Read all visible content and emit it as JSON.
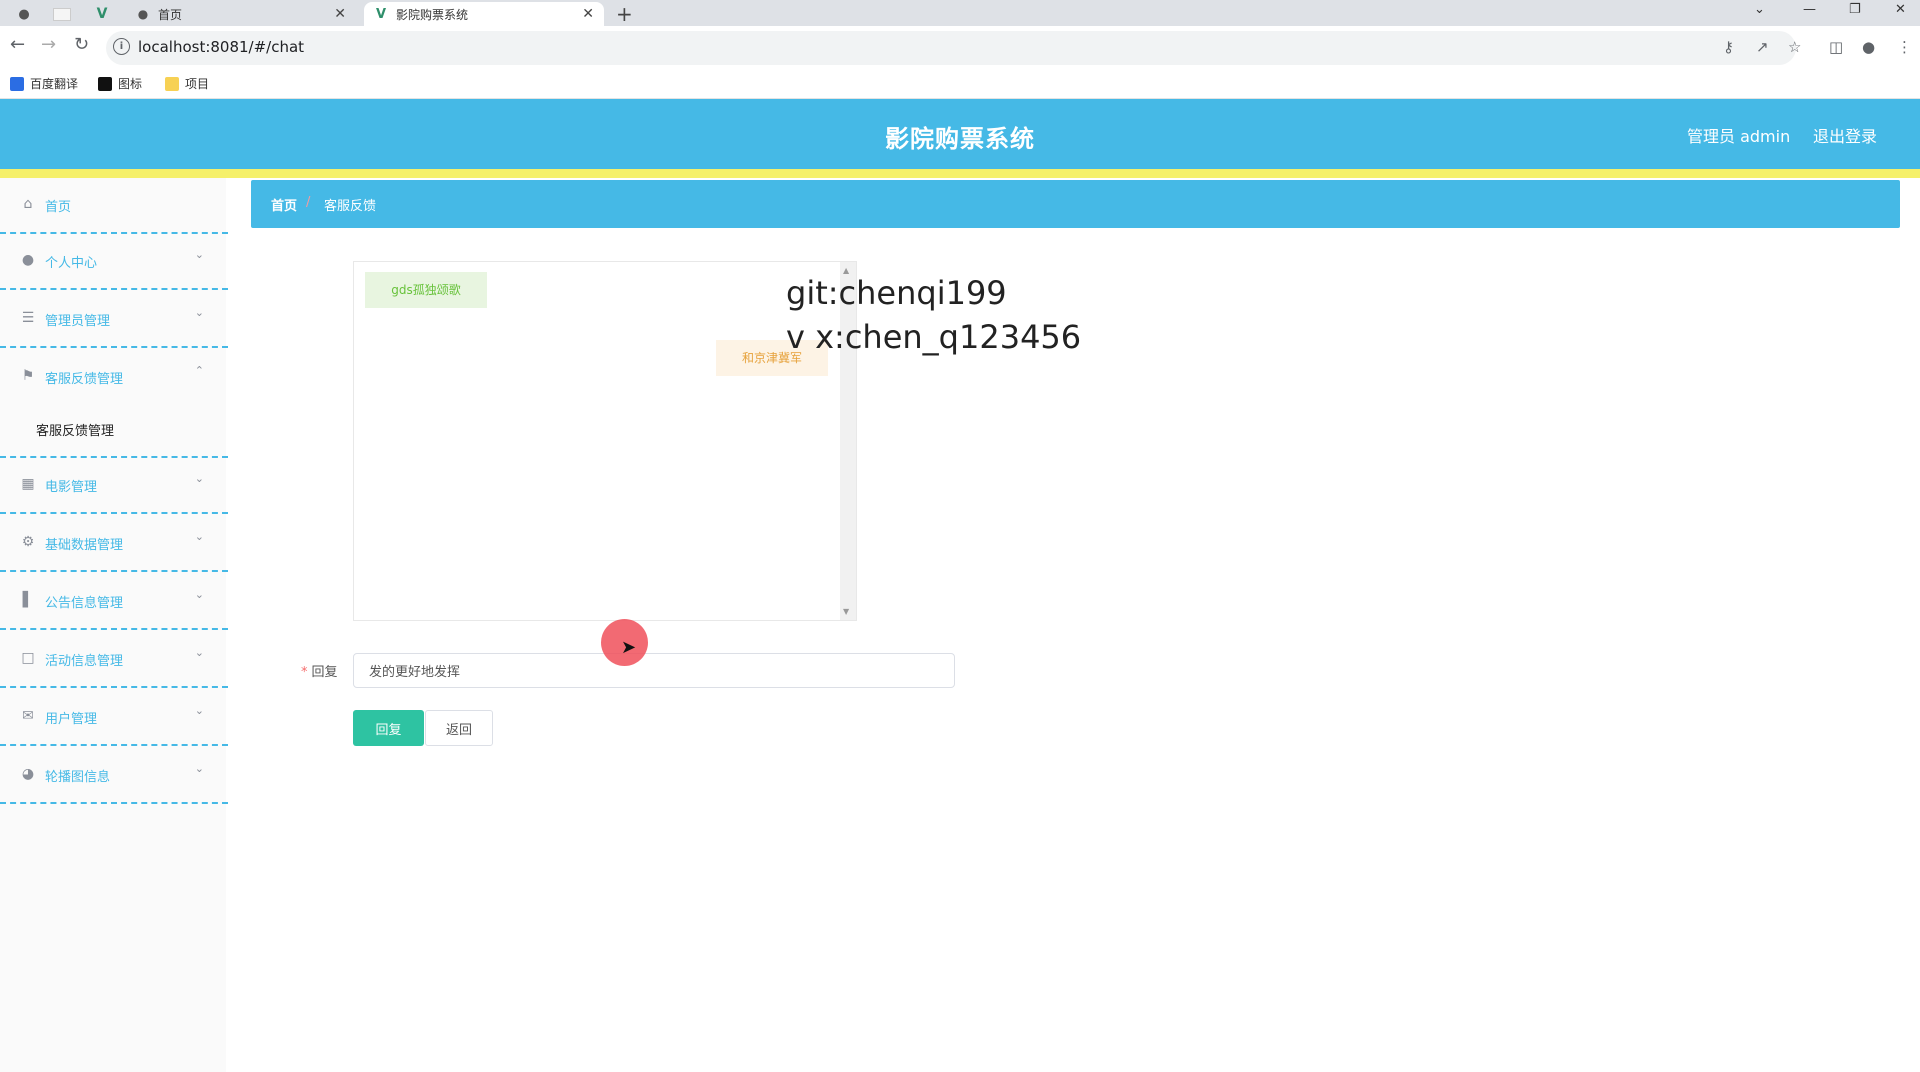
{
  "browser": {
    "tabs": [
      {
        "title": "首页"
      },
      {
        "title": "影院购票系统"
      }
    ],
    "new_tab": "+",
    "url": "localhost:8081/#/chat",
    "bookmarks": [
      {
        "label": "百度翻译"
      },
      {
        "label": "图标"
      },
      {
        "label": "项目"
      }
    ]
  },
  "header": {
    "title": "影院购票系统",
    "admin": "管理员 admin",
    "logout": "退出登录"
  },
  "sidebar": {
    "items": [
      {
        "label": "首页",
        "icon": "home-icon"
      },
      {
        "label": "个人中心",
        "icon": "user-icon"
      },
      {
        "label": "管理员管理",
        "icon": "list-icon"
      },
      {
        "label": "客服反馈管理",
        "icon": "flag-icon"
      },
      {
        "label": "电影管理",
        "icon": "grid-icon"
      },
      {
        "label": "基础数据管理",
        "icon": "settings-icon"
      },
      {
        "label": "公告信息管理",
        "icon": "bar-chart-icon"
      },
      {
        "label": "活动信息管理",
        "icon": "chat-icon"
      },
      {
        "label": "用户管理",
        "icon": "mail-icon"
      },
      {
        "label": "轮播图信息",
        "icon": "gauge-icon"
      }
    ],
    "submenu": "客服反馈管理"
  },
  "breadcrumb": {
    "home": "首页",
    "separator": "/",
    "current": "客服反馈"
  },
  "chat": {
    "messages": [
      {
        "side": "left",
        "text": "gds孤独颂歌"
      },
      {
        "side": "right",
        "text": "和京津冀军"
      }
    ]
  },
  "overlay": {
    "line1": "git:chenqi199",
    "line2": "v x:chen_q123456"
  },
  "form": {
    "reply_label": "回复",
    "required_mark": "*",
    "reply_value": "发的更好地发挥",
    "submit": "回复",
    "back": "返回"
  },
  "colors": {
    "header": "#45b9e6",
    "accent_bar": "#f5f06a",
    "submit_button": "#2ec3a2"
  }
}
